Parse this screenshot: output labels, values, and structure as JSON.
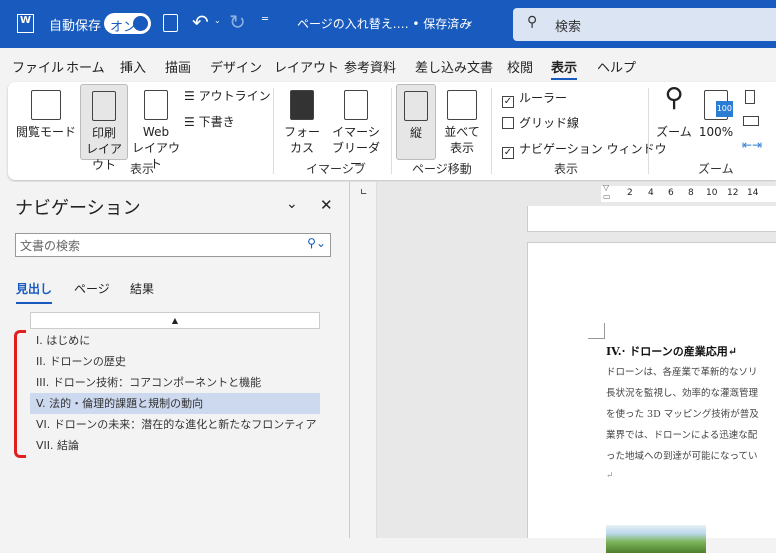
{
  "titlebar": {
    "autosave_label": "自動保存",
    "autosave_state": "オン",
    "doc_title": "ページの入れ替え.… • 保存済み",
    "search_placeholder": "検索"
  },
  "menu": [
    "ファイル",
    "ホーム",
    "挿入",
    "描画",
    "デザイン",
    "レイアウト",
    "参考資料",
    "差し込み文書",
    "校閲",
    "表示",
    "ヘルプ"
  ],
  "ribbon": {
    "views": {
      "reading": "閲覧モード",
      "print": "印刷\nレイアウト",
      "web": "Web\nレイアウト",
      "outline": "アウトライン",
      "draft": "下書き",
      "group": "表示"
    },
    "immersive": {
      "focus": "フォー\nカス",
      "reader": "イマーシ\nブリーダー",
      "group": "イマーシブ"
    },
    "pagemove": {
      "vertical": "縦",
      "side": "並べて\n表示",
      "group": "ページ移動"
    },
    "show": {
      "ruler": "ルーラー",
      "gridlines": "グリッド線",
      "navpane": "ナビゲーション ウィンドウ",
      "group": "表示",
      "ruler_checked": true,
      "gridlines_checked": false,
      "navpane_checked": true
    },
    "zoom": {
      "zoom": "ズーム",
      "hundred": "100%",
      "group": "ズーム",
      "badge": "100"
    }
  },
  "nav": {
    "title": "ナビゲーション",
    "search_placeholder": "文書の検索",
    "tabs": [
      "見出し",
      "ページ",
      "結果"
    ],
    "headings": [
      "I. はじめに",
      "II. ドローンの歴史",
      "III. ドローン技術：コアコンポーネントと機能",
      "V. 法的・倫理的課題と規制の動向",
      "VI. ドローンの未来：潜在的な進化と新たなフロンティア",
      "VII. 結論"
    ],
    "selected_index": 3
  },
  "ruler": [
    "2",
    "4",
    "6",
    "8",
    "10",
    "12",
    "14"
  ],
  "document": {
    "heading": "IV.· ドローンの産業応用↵",
    "lines": [
      "ドローンは、各産業で革新的なソリ",
      "長状況を監視し、効率的な灌漑管理",
      "を使った 3D マッピング技術が普及",
      "業界では、ドローンによる迅速な配",
      "った地域への到達が可能になってい"
    ],
    "para_mark": "↵"
  }
}
